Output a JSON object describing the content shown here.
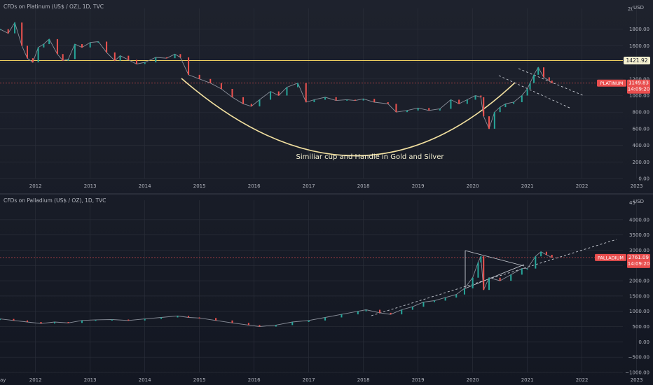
{
  "chart_data": [
    {
      "type": "line",
      "title": "CFDs on Platinum (US$ / OZ), 1D, TVC",
      "currency_label": "USD",
      "xlabel": "",
      "ylabel": "",
      "ylim": [
        0,
        2000
      ],
      "y_ticks": [
        0,
        200,
        400,
        600,
        800,
        1000,
        1200,
        1400,
        1600,
        1800
      ],
      "y_tick_labels": [
        "0.00",
        "200.00",
        "400.00",
        "600.00",
        "800.00",
        "1000.00",
        "1200.00",
        "1400.00",
        "1600.00",
        "1800.00"
      ],
      "top_tick_label": "2(",
      "xlim": [
        2011.35,
        2023.3
      ],
      "x_ticks": [
        "2012",
        "2013",
        "2014",
        "2015",
        "2016",
        "2017",
        "2018",
        "2019",
        "2020",
        "2021",
        "2022",
        "2023"
      ],
      "grid": true,
      "series": [
        {
          "name": "PLATINUM",
          "x": [
            2011.35,
            2011.5,
            2011.62,
            2011.75,
            2011.85,
            2011.95,
            2012.05,
            2012.15,
            2012.25,
            2012.4,
            2012.5,
            2012.6,
            2012.72,
            2012.85,
            2013.0,
            2013.15,
            2013.3,
            2013.45,
            2013.55,
            2013.7,
            2013.85,
            2014.0,
            2014.2,
            2014.4,
            2014.55,
            2014.65,
            2014.8,
            2015.0,
            2015.2,
            2015.4,
            2015.6,
            2015.8,
            2015.95,
            2016.1,
            2016.3,
            2016.45,
            2016.6,
            2016.8,
            2016.95,
            2017.1,
            2017.3,
            2017.5,
            2017.7,
            2017.85,
            2018.0,
            2018.2,
            2018.45,
            2018.6,
            2018.8,
            2019.0,
            2019.2,
            2019.4,
            2019.6,
            2019.75,
            2019.9,
            2020.05,
            2020.15,
            2020.2,
            2020.3,
            2020.4,
            2020.5,
            2020.6,
            2020.75,
            2020.9,
            2021.0,
            2021.05,
            2021.12,
            2021.2,
            2021.3,
            2021.4,
            2021.45
          ],
          "y": [
            1800,
            1750,
            1880,
            1600,
            1450,
            1400,
            1580,
            1620,
            1680,
            1500,
            1420,
            1440,
            1620,
            1580,
            1640,
            1650,
            1520,
            1420,
            1480,
            1430,
            1380,
            1400,
            1460,
            1450,
            1500,
            1460,
            1250,
            1200,
            1150,
            1080,
            980,
            900,
            870,
            950,
            1050,
            1000,
            1100,
            1150,
            920,
            950,
            980,
            940,
            950,
            940,
            960,
            920,
            900,
            800,
            820,
            850,
            820,
            840,
            950,
            900,
            950,
            1000,
            980,
            750,
            600,
            800,
            860,
            900,
            920,
            1000,
            1080,
            1150,
            1250,
            1340,
            1220,
            1180,
            1150
          ]
        }
      ],
      "price_badge": {
        "label": "PLATINUM",
        "value": "1149.83",
        "time": "14:09:20",
        "price": 1149.83
      },
      "resistance_line": {
        "label": "1421.92",
        "price": 1421.92
      },
      "annotation": "Similiar cup and Handle in Gold and Silver"
    },
    {
      "type": "line",
      "title": "CFDs on Palladium (US$ / OZ), 1D, TVC",
      "currency_label": "USD",
      "xlabel": "",
      "ylabel": "",
      "ylim": [
        -1000,
        4500
      ],
      "y_ticks": [
        -1000,
        -500,
        0,
        500,
        1000,
        1500,
        2000,
        2500,
        3000,
        3500,
        4000
      ],
      "y_tick_labels": [
        "−1000.00",
        "−500.00",
        "0.00",
        "500.00",
        "1000.00",
        "1500.00",
        "2000.00",
        "2500.00",
        "3000.00",
        "3500.00",
        "4000.00"
      ],
      "top_tick_label": "45",
      "xlim": [
        2011.35,
        2023.3
      ],
      "x_ticks": [
        "2012",
        "2013",
        "2014",
        "2015",
        "2016",
        "2017",
        "2018",
        "2019",
        "2020",
        "2021",
        "2022",
        "2023"
      ],
      "left_edge_label": "ay",
      "grid": true,
      "series": [
        {
          "name": "PALLADIUM",
          "x": [
            2011.35,
            2011.6,
            2011.85,
            2012.1,
            2012.35,
            2012.6,
            2012.85,
            2013.1,
            2013.4,
            2013.7,
            2014.0,
            2014.3,
            2014.6,
            2014.8,
            2015.0,
            2015.3,
            2015.6,
            2015.9,
            2016.1,
            2016.4,
            2016.7,
            2017.0,
            2017.3,
            2017.6,
            2017.9,
            2018.05,
            2018.3,
            2018.5,
            2018.7,
            2018.9,
            2019.1,
            2019.3,
            2019.5,
            2019.7,
            2019.85,
            2020.0,
            2020.1,
            2020.15,
            2020.2,
            2020.3,
            2020.5,
            2020.7,
            2020.9,
            2021.0,
            2021.15,
            2021.25,
            2021.35,
            2021.45
          ],
          "y": [
            750,
            700,
            650,
            600,
            650,
            620,
            700,
            720,
            730,
            700,
            750,
            800,
            850,
            800,
            780,
            700,
            620,
            550,
            500,
            550,
            650,
            700,
            800,
            900,
            1000,
            1050,
            950,
            900,
            1050,
            1150,
            1300,
            1350,
            1450,
            1550,
            1750,
            2100,
            2600,
            2800,
            1700,
            2100,
            2000,
            2200,
            2400,
            2400,
            2800,
            2950,
            2850,
            2761
          ]
        }
      ],
      "price_badge": {
        "label": "PALLADIUM",
        "value": "2761.09",
        "time": "14:09:20",
        "price": 2761.09
      }
    }
  ]
}
